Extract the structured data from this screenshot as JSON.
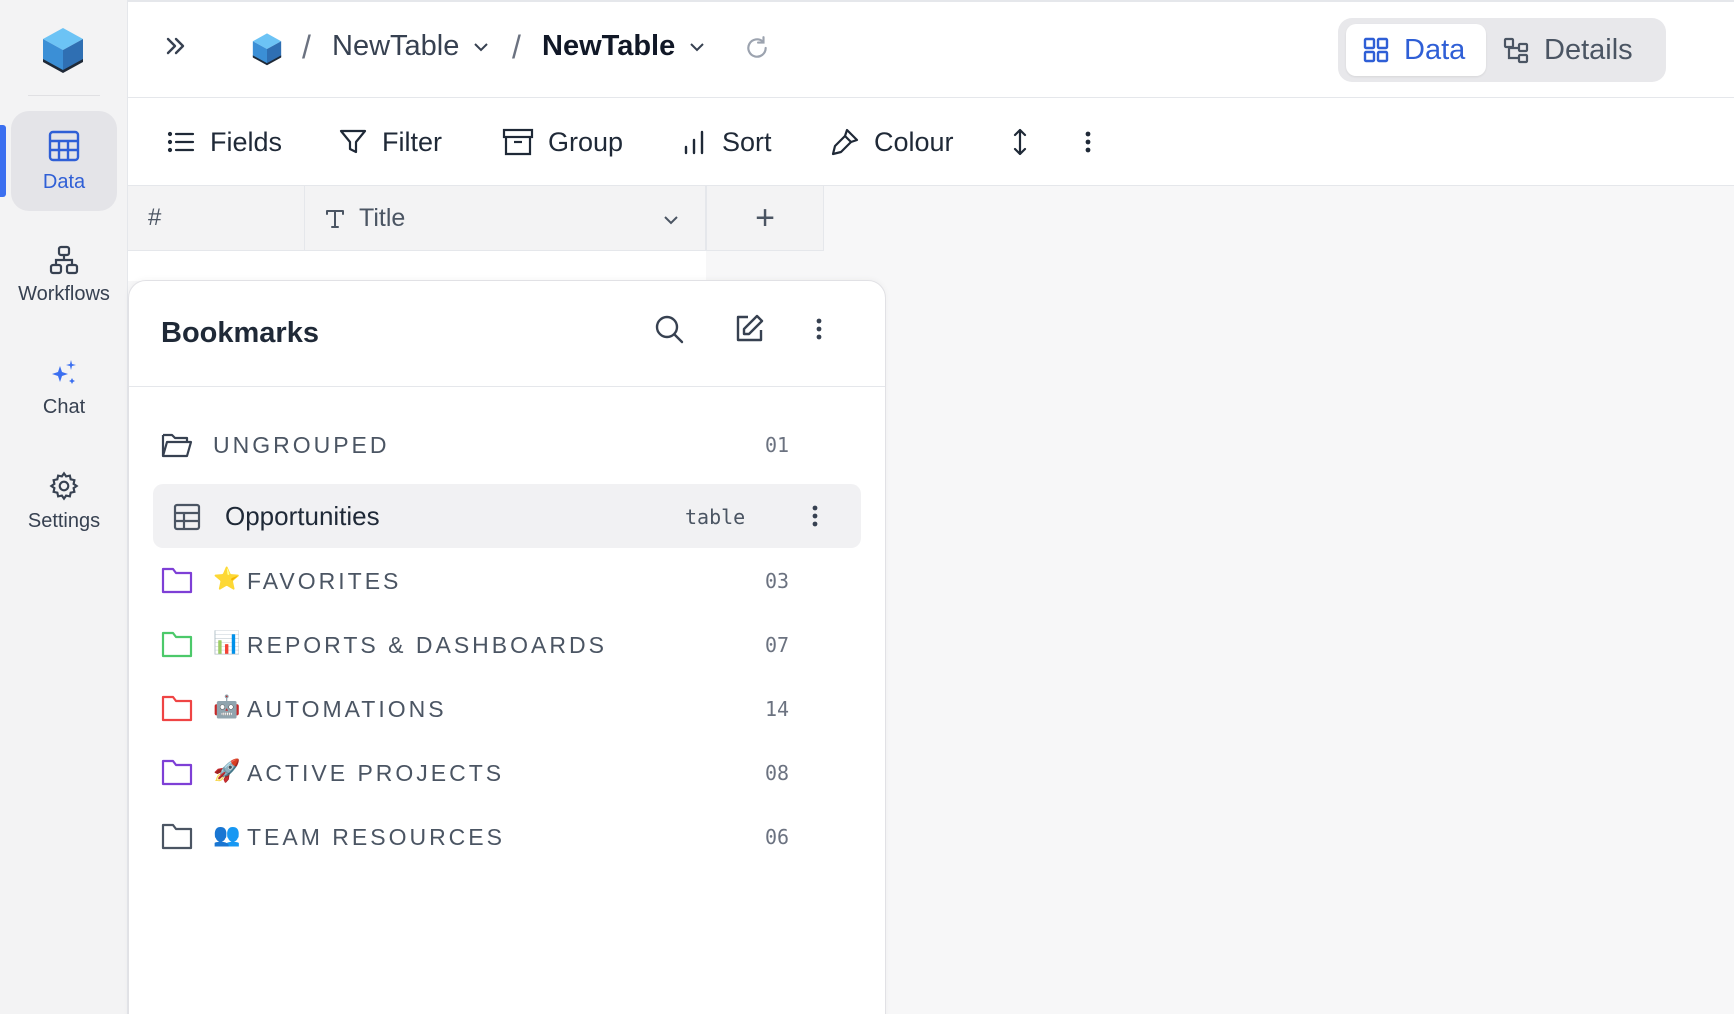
{
  "sidebar": {
    "items": [
      {
        "label": "Data",
        "icon": "table-grid-icon",
        "active": true
      },
      {
        "label": "Workflows",
        "icon": "workflow-icon"
      },
      {
        "label": "Chat",
        "icon": "sparkles-icon"
      },
      {
        "label": "Settings",
        "icon": "gear-icon"
      }
    ]
  },
  "header": {
    "breadcrumb": [
      {
        "label": "NewTable"
      },
      {
        "label": "NewTable"
      }
    ],
    "separator": "/",
    "view_toggle": {
      "data": "Data",
      "details": "Details",
      "selected": "Data"
    }
  },
  "toolbar": {
    "fields": "Fields",
    "filter": "Filter",
    "group": "Group",
    "sort": "Sort",
    "colour": "Colour"
  },
  "grid": {
    "columns": [
      {
        "label": "#"
      },
      {
        "label": "Title",
        "icon": "text-type-icon"
      }
    ],
    "add_column": "+"
  },
  "bookmarks": {
    "title": "Bookmarks",
    "groups": [
      {
        "name": "UNGROUPED",
        "count": "01",
        "emoji": "",
        "folder_color": "#374151"
      },
      {
        "name": "FAVORITES",
        "count": "03",
        "emoji": "⭐",
        "folder_color": "#7e3fd6"
      },
      {
        "name": "REPORTS & DASHBOARDS",
        "count": "07",
        "emoji": "📊",
        "folder_color": "#4cc96a"
      },
      {
        "name": "AUTOMATIONS",
        "count": "14",
        "emoji": "🤖",
        "folder_color": "#ef4444"
      },
      {
        "name": "ACTIVE PROJECTS",
        "count": "08",
        "emoji": "🚀",
        "folder_color": "#7e3fd6"
      },
      {
        "name": "TEAM RESOURCES",
        "count": "06",
        "emoji": "👥",
        "folder_color": "#4b5563"
      }
    ],
    "item": {
      "name": "Opportunities",
      "type": "table"
    }
  },
  "colors": {
    "accent": "#2f5fd6",
    "logo": "#4aa8e8"
  }
}
